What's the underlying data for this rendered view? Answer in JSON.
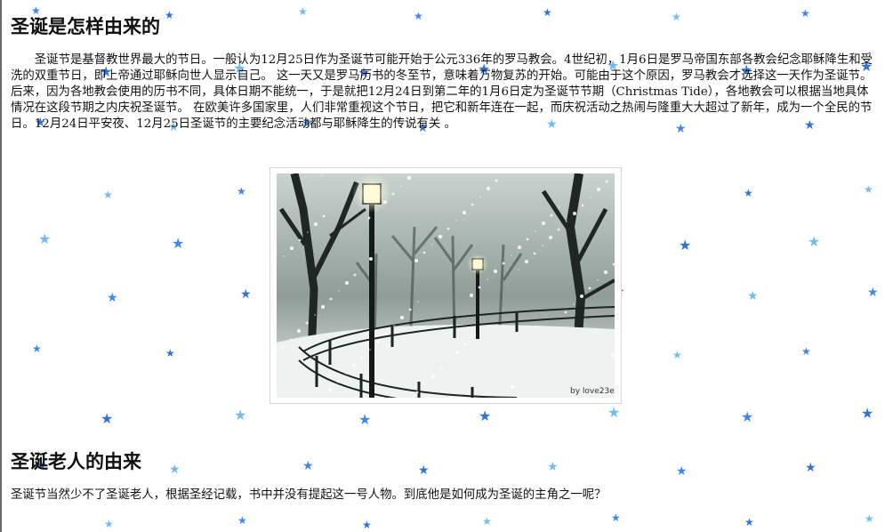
{
  "article": {
    "heading_1": "圣诞是怎样由来的",
    "paragraph_1": "圣诞节是基督教世界最大的节日。一般认为12月25日作为圣诞节可能开始于公元336年的罗马教会。4世纪初，1月6日是罗马帝国东部各教会纪念耶稣降生和受洗的双重节日，即上帝通过耶稣向世人显示自己。 这一天又是罗马历书的冬至节，意味着万物复苏的开始。可能由于这个原因，罗马教会才选择这一天作为圣诞节。后来，因为各地教会使用的历书不同，具体日期不能统一，于是就把12月24日到第二年的1月6日定为圣诞节节期（Christmas Tide），各地教会可以根据当地具体情况在这段节期之内庆祝圣诞节。 在欧美许多国家里，人们非常重视这个节日，把它和新年连在一起，而庆祝活动之热闹与隆重大大超过了新年，成为一个全民的节日。12月24日平安夜、12月25日圣诞节的主要纪念活动都与耶稣降生的传说有关 。",
    "heading_2": "圣诞老人的由来",
    "paragraph_2": "圣诞节当然少不了圣诞老人，根据圣经记载，书中并没有提起这一号人物。到底他是如何成为圣诞的主角之一呢？"
  },
  "image": {
    "watermark": "by love23ee"
  },
  "background": {
    "star_icon": "star-icon",
    "colors": [
      "#3f86e8",
      "#6fbdf0",
      "#2f73d8"
    ]
  }
}
